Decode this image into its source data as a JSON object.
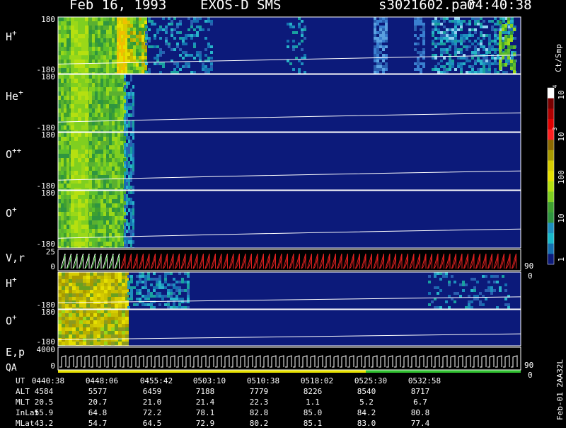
{
  "header": {
    "date": "Feb 16, 1993",
    "instrument": "EXOS-D SMS",
    "file": "s3021602.par",
    "time": "04:40:38"
  },
  "panels": [
    {
      "label": "H",
      "sup": "+",
      "ymax": "180",
      "ymin": "-180"
    },
    {
      "label": "He",
      "sup": "+",
      "ymax": "180",
      "ymin": "-180"
    },
    {
      "label": "O",
      "sup": "++",
      "ymax": "180",
      "ymin": "-180"
    },
    {
      "label": "O",
      "sup": "+",
      "ymax": "180",
      "ymin": "-180"
    },
    {
      "label": "V,r",
      "sup": "",
      "ymax": "25",
      "ymin": "0",
      "right_top": "90",
      "right_bot": "0"
    },
    {
      "label": "H",
      "sup": "+",
      "ymax": "",
      "ymin": "-180"
    },
    {
      "label": "O",
      "sup": "+",
      "ymax": "180",
      "ymin": "-180"
    },
    {
      "label": "E,p",
      "sup": "",
      "ymax": "4000",
      "ymin": "0",
      "right_top": "90",
      "right_bot": "0"
    }
  ],
  "qa_label": "QA",
  "colorbar": {
    "unit": "Ct/Smp",
    "ticks": [
      "10",
      "4",
      "10",
      "3",
      "100",
      "10",
      "1"
    ]
  },
  "footer_id": "Feb-01 2AA32L",
  "chart_data": {
    "type": "heatmap",
    "time_axis": {
      "label": "UT",
      "ticks": [
        "0440:38",
        "0448:06",
        "0455:42",
        "0503:10",
        "0510:38",
        "0518:02",
        "0525:30",
        "0532:58"
      ]
    },
    "ephemeris": [
      {
        "name": "ALT",
        "values": [
          "4584",
          "5577",
          "6459",
          "7188",
          "7779",
          "8226",
          "8540",
          "8717"
        ]
      },
      {
        "name": "MLT",
        "values": [
          "20.5",
          "20.7",
          "21.0",
          "21.4",
          "22.3",
          "1.1",
          "5.2",
          "6.7"
        ]
      },
      {
        "name": "InLat",
        "values": [
          "55.9",
          "64.8",
          "72.2",
          "78.1",
          "82.8",
          "85.0",
          "84.2",
          "80.8"
        ]
      },
      {
        "name": "MLat",
        "values": [
          "43.2",
          "54.7",
          "64.5",
          "72.9",
          "80.2",
          "85.1",
          "83.0",
          "77.4"
        ]
      }
    ],
    "colorbar_scale": "log",
    "colorbar_range": [
      1,
      10000
    ]
  }
}
